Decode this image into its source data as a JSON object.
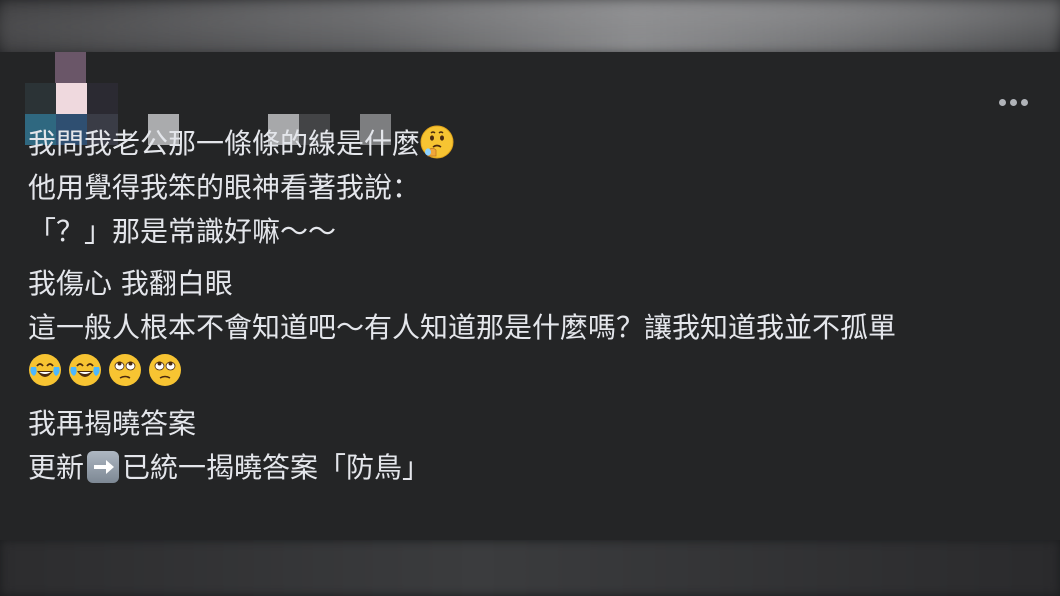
{
  "post": {
    "author": {
      "avatar_alt": "pixelated-avatar",
      "name_obscured": true
    },
    "menu_icon": "more-horizontal-icon",
    "paragraphs": [
      {
        "lines": [
          {
            "text": "我問我老公那一條條的線是什麼",
            "trailing_emoji": "thinking-drool-face-icon"
          },
          {
            "text": "他用覺得我笨的眼神看著我說："
          },
          {
            "text": "「？」那是常識好嘛～～"
          }
        ]
      },
      {
        "lines": [
          {
            "text": "我傷心 我翻白眼"
          },
          {
            "text": "這一般人根本不會知道吧～有人知道那是什麼嗎？讓我知道我並不孤單"
          },
          {
            "emojis": [
              "tears-of-joy-icon",
              "tears-of-joy-icon",
              "eye-roll-face-icon",
              "eye-roll-face-icon"
            ]
          }
        ]
      },
      {
        "lines": [
          {
            "text": "我再揭曉答案"
          },
          {
            "before": "更新",
            "arrow_icon": "right-arrow-icon",
            "after": "已統一揭曉答案「防鳥」"
          }
        ]
      }
    ]
  },
  "colors": {
    "card_background": "#242526",
    "text": "#e4e6eb",
    "icon": "#b0b3b8"
  }
}
